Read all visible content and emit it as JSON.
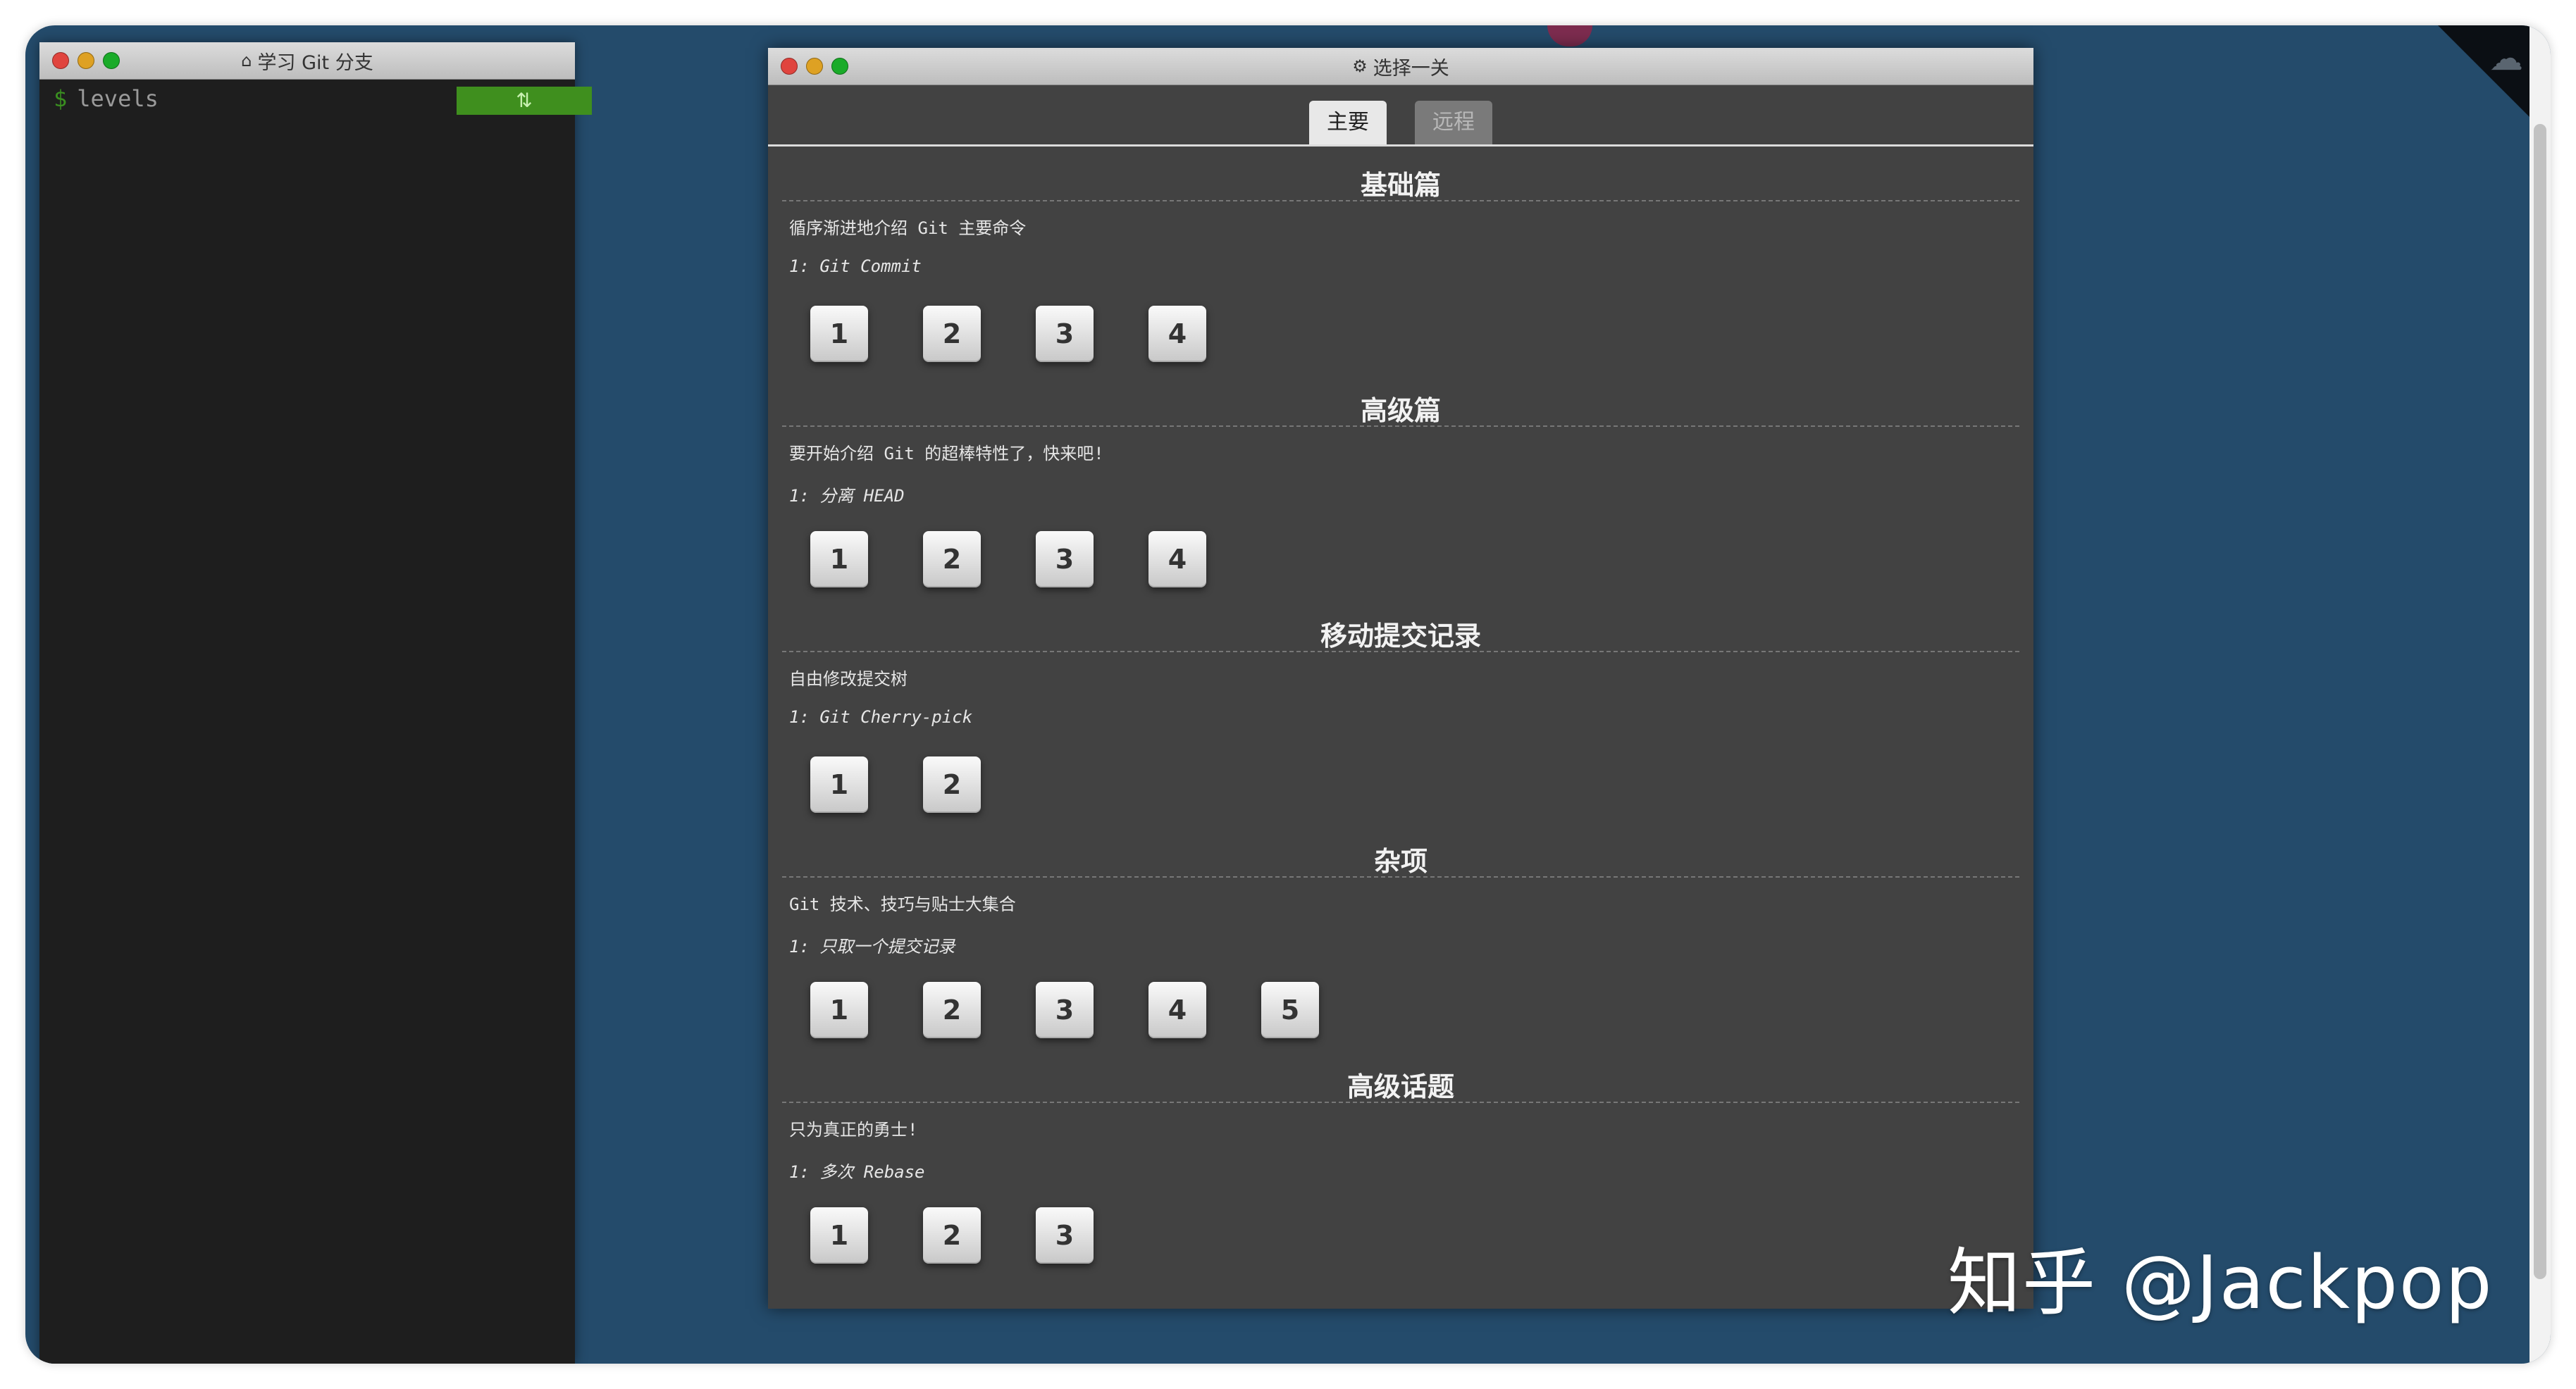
{
  "terminal": {
    "title": "学习 Git 分支",
    "title_icon": "home-icon",
    "prompt": "$",
    "command": "levels",
    "badge_icon": "sync-icon"
  },
  "dialog": {
    "title": "选择一关",
    "title_icon": "gear-icon",
    "tabs": [
      {
        "label": "主要",
        "active": true
      },
      {
        "label": "远程",
        "active": false
      }
    ],
    "sections": [
      {
        "title": "基础篇",
        "desc": "循序渐进地介绍 Git 主要命令",
        "sub": "1: Git Commit",
        "levels": [
          "1",
          "2",
          "3",
          "4"
        ]
      },
      {
        "title": "高级篇",
        "desc": "要开始介绍 Git 的超棒特性了，快来吧!",
        "sub": "1: 分离 HEAD",
        "levels": [
          "1",
          "2",
          "3",
          "4"
        ]
      },
      {
        "title": "移动提交记录",
        "desc": "自由修改提交树",
        "sub": "1: Git Cherry-pick",
        "levels": [
          "1",
          "2"
        ]
      },
      {
        "title": "杂项",
        "desc": "Git 技术、技巧与贴士大集合",
        "sub": "1: 只取一个提交记录",
        "levels": [
          "1",
          "2",
          "3",
          "4",
          "5"
        ]
      },
      {
        "title": "高级话题",
        "desc": "只为真正的勇士!",
        "sub": "1: 多次 Rebase",
        "levels": [
          "1",
          "2",
          "3"
        ]
      }
    ]
  },
  "watermark": "知乎 @Jackpop",
  "colors": {
    "desktop": "#244b6b",
    "dialog_bg": "#424242",
    "terminal_bg": "#1e1e1e",
    "badge_green": "#3f8f1e"
  }
}
